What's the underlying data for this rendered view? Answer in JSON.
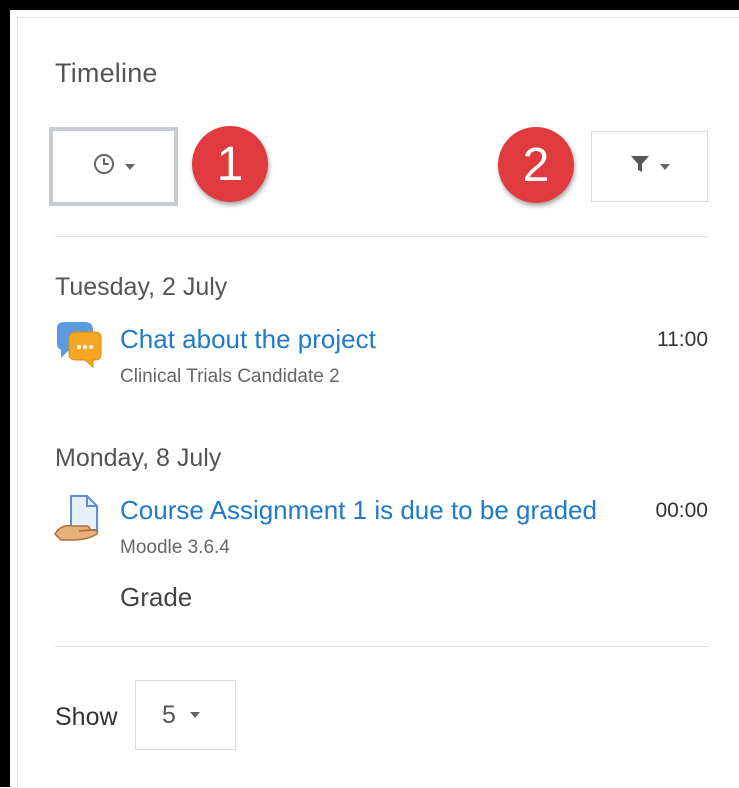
{
  "timeline": {
    "title": "Timeline",
    "sort_button": {
      "icon": "clock-icon"
    },
    "filter_button": {
      "icon": "filter-icon"
    },
    "badges": [
      "1",
      "2"
    ]
  },
  "events": [
    {
      "date": "Tuesday, 2 July",
      "icon": "chat-icon",
      "title": "Chat about the project",
      "course": "Clinical Trials Candidate 2",
      "time": "11:00"
    },
    {
      "date": "Monday, 8 July",
      "icon": "assignment-icon",
      "title": "Course Assignment 1 is due to be graded",
      "course": "Moodle 3.6.4",
      "time": "00:00",
      "action": "Grade"
    }
  ],
  "footer": {
    "show_label": "Show",
    "show_value": "5"
  },
  "colors": {
    "link": "#1f7acb",
    "badge": "#df3b3f"
  }
}
